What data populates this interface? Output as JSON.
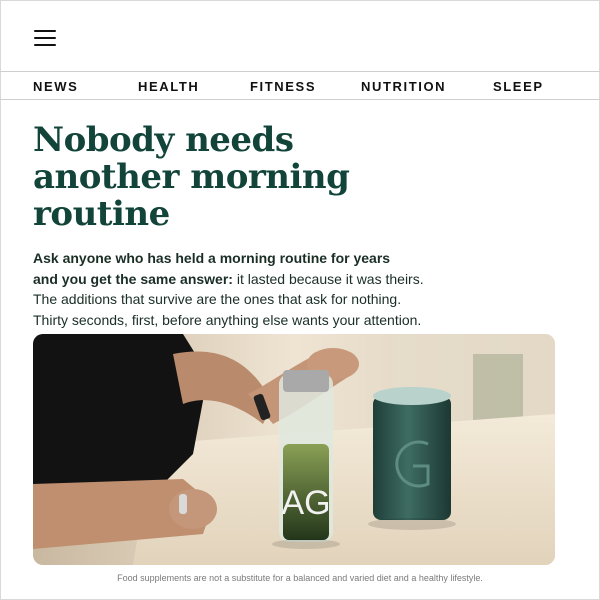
{
  "header": {
    "menu_icon": "hamburger-menu-icon"
  },
  "nav": {
    "items": [
      {
        "label": "NEWS"
      },
      {
        "label": "HEALTH"
      },
      {
        "label": "FITNESS"
      },
      {
        "label": "NUTRITION"
      },
      {
        "label": "SLEEP"
      }
    ]
  },
  "article": {
    "headline": [
      "Nobody needs",
      "another morning",
      "routine"
    ],
    "lede_bold_1": "Ask anyone who has held a morning routine for years",
    "lede_bold_2": "and you get the same answer:",
    "lede_rest_2": " it lasted because it was theirs.",
    "lede_3": "The additions that survive are the ones that ask for nothing.",
    "lede_4": "Thirty seconds, first, before anything else wants your attention.",
    "hero_bottle_text": "AG"
  },
  "footer": {
    "disclaimer": "Food supplements are not a substitute for a balanced and varied diet and a healthy lifestyle."
  },
  "colors": {
    "headline": "#12443a",
    "canister": "#2f5a52",
    "drink": "#3c5a22"
  }
}
